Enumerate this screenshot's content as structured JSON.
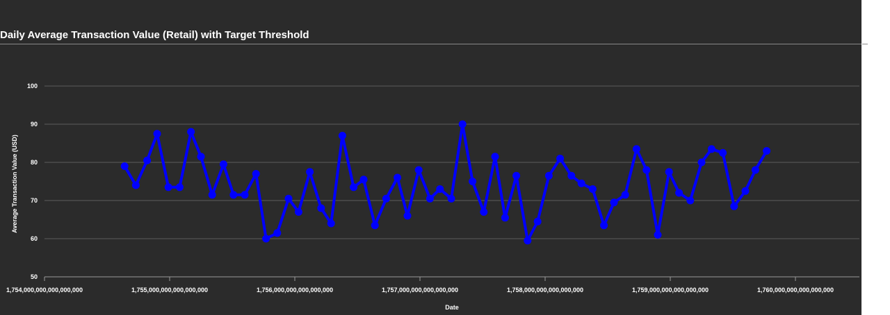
{
  "chart_data": {
    "type": "line",
    "title": "Daily Average Transaction Value (Retail) with Target Threshold",
    "xlabel": "Date",
    "ylabel": "Average Transaction Value (USD)",
    "xlim": [
      1.754e+21,
      1.7605e+21
    ],
    "ylim": [
      50,
      100
    ],
    "x_ticks": [
      {
        "value": 1.754e+21,
        "label": "1,754,000,000,000,000,000"
      },
      {
        "value": 1.755e+21,
        "label": "1,755,000,000,000,000,000"
      },
      {
        "value": 1.756e+21,
        "label": "1,756,000,000,000,000,000"
      },
      {
        "value": 1.757e+21,
        "label": "1,757,000,000,000,000,000"
      },
      {
        "value": 1.758e+21,
        "label": "1,758,000,000,000,000,000"
      },
      {
        "value": 1.759e+21,
        "label": "1,759,000,000,000,000,000"
      },
      {
        "value": 1.76e+21,
        "label": "1,760,000,000,000,000,000"
      }
    ],
    "y_ticks": [
      {
        "value": 50,
        "label": "50"
      },
      {
        "value": 60,
        "label": "60"
      },
      {
        "value": 70,
        "label": "70"
      },
      {
        "value": 80,
        "label": "80"
      },
      {
        "value": 90,
        "label": "90"
      },
      {
        "value": 100,
        "label": "100"
      }
    ],
    "grid": true,
    "legend": "none",
    "series": [
      {
        "color": "#0000ff",
        "x": [
          1.75464e+21,
          1.75473e+21,
          1.75482e+21,
          1.7549e+21,
          1.75499e+21,
          1.75508e+21,
          1.75517e+21,
          1.75525e+21,
          1.75534e+21,
          1.75543e+21,
          1.75551e+21,
          1.7556e+21,
          1.75569e+21,
          1.75577e+21,
          1.75586e+21,
          1.75595e+21,
          1.75603e+21,
          1.75612e+21,
          1.75621e+21,
          1.75629e+21,
          1.75638e+21,
          1.75647e+21,
          1.75655e+21,
          1.75664e+21,
          1.75673e+21,
          1.75682e+21,
          1.7569e+21,
          1.75699e+21,
          1.75708e+21,
          1.75716e+21,
          1.75725e+21,
          1.75734e+21,
          1.75742e+21,
          1.75751e+21,
          1.7576e+21,
          1.75768e+21,
          1.75777e+21,
          1.75786e+21,
          1.75794e+21,
          1.75803e+21,
          1.75812e+21,
          1.75821e+21,
          1.75829e+21,
          1.75838e+21,
          1.75847e+21,
          1.75855e+21,
          1.75864e+21,
          1.75873e+21,
          1.75881e+21,
          1.7589e+21,
          1.75899e+21,
          1.75907e+21,
          1.75916e+21,
          1.75925e+21,
          1.75933e+21,
          1.75942e+21,
          1.75951e+21,
          1.7596e+21,
          1.75968e+21,
          1.75977e+21
        ],
        "y": [
          79,
          74,
          80.5,
          87.5,
          73.5,
          73.5,
          88,
          81.5,
          71.5,
          79.5,
          71.5,
          71.5,
          77,
          60,
          61.5,
          70.5,
          67,
          77.5,
          68,
          64,
          87,
          73.5,
          75.5,
          63.5,
          70.5,
          76,
          66,
          78,
          70.5,
          73,
          70.5,
          90,
          75,
          67,
          81.5,
          65.5,
          76.5,
          59.5,
          64.5,
          76.5,
          81,
          76.5,
          74.5,
          73,
          63.5,
          69.5,
          71.5,
          83.5,
          78,
          61,
          77.5,
          72,
          70,
          80,
          83.5,
          82.5,
          68.5,
          72.5,
          78,
          83
        ]
      }
    ]
  }
}
